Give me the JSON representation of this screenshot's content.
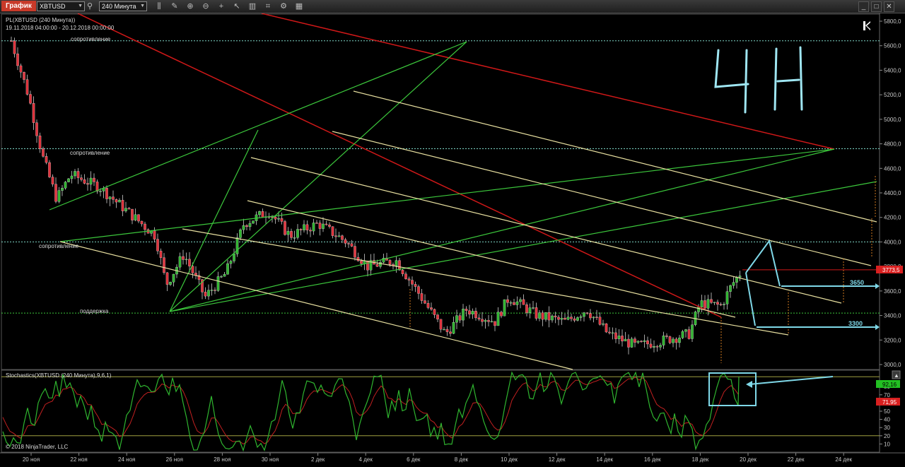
{
  "toolbar": {
    "title": "График",
    "instrument": "XBTUSD",
    "timeframe": "240 Минута"
  },
  "price_chart": {
    "header": "PL(XBTUSD (240 Минута))",
    "range": "19.11.2018 04:00:00 - 20.12.2018 00:00:00",
    "labels": {
      "res1": "сопротивление",
      "res2": "сопротивление",
      "res3": "сопротивление",
      "support": "поддержка",
      "target1": "3650",
      "target2": "3300",
      "handwriting": "4H"
    },
    "last_price": "3773,5",
    "y_ticks": [
      "5800,0",
      "5600,0",
      "5400,0",
      "5200,0",
      "5000,0",
      "4800,0",
      "4600,0",
      "4400,0",
      "4200,0",
      "4000,0",
      "3800,0",
      "3600,0",
      "3400,0",
      "3200,0",
      "3000,0"
    ]
  },
  "stoch": {
    "header": "Stochastics(XBTUSD (240 Минута),9,6,1)",
    "copyright": "© 2018 NinjaTrader, LLC",
    "k_value": "92,16",
    "d_value": "71,95",
    "y_ticks": [
      "80",
      "70",
      "60",
      "50",
      "40",
      "30",
      "20",
      "10"
    ]
  },
  "x_axis": [
    "20 ноя",
    "22 ноя",
    "24 ноя",
    "26 ноя",
    "28 ноя",
    "30 ноя",
    "2 дек",
    "4 дек",
    "6 дек",
    "8 дек",
    "10 дек",
    "12 дек",
    "14 дек",
    "16 дек",
    "18 дек",
    "20 дек",
    "22 дек",
    "24 дек"
  ],
  "colors": {
    "up": "#2fb52f",
    "down": "#e0303a",
    "channel": "#e8e0a0",
    "fan": "#3cc83c",
    "trend": "#d01818",
    "guide": "#7fd8e8"
  }
}
